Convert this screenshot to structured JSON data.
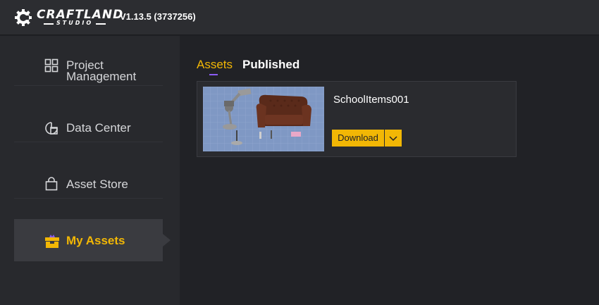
{
  "app": {
    "logo_text": "CRAFTLAND",
    "logo_subtext": "STUDIO",
    "version": "V1.13.5 (3737256)"
  },
  "sidebar": {
    "items": [
      {
        "label_line1": "Project",
        "label_line2": "Management",
        "icon": "grid-icon",
        "active": false
      },
      {
        "label": "Data Center",
        "icon": "data-center-icon",
        "active": false
      },
      {
        "label": "Asset Store",
        "icon": "shopping-bag-icon",
        "active": false
      },
      {
        "label": "My Assets",
        "icon": "treasure-chest-icon",
        "active": true
      }
    ]
  },
  "main": {
    "tabs": [
      {
        "label": "Assets",
        "active": true
      },
      {
        "label": "Published",
        "active": false
      }
    ],
    "assets": [
      {
        "name": "SchoolItems001",
        "download_label": "Download"
      }
    ]
  },
  "colors": {
    "accent": "#f2b705",
    "tab_indicator": "#8b5cf6",
    "background": "#1f2024",
    "sidebar": "#28292d",
    "active_item": "#3a3b40"
  }
}
